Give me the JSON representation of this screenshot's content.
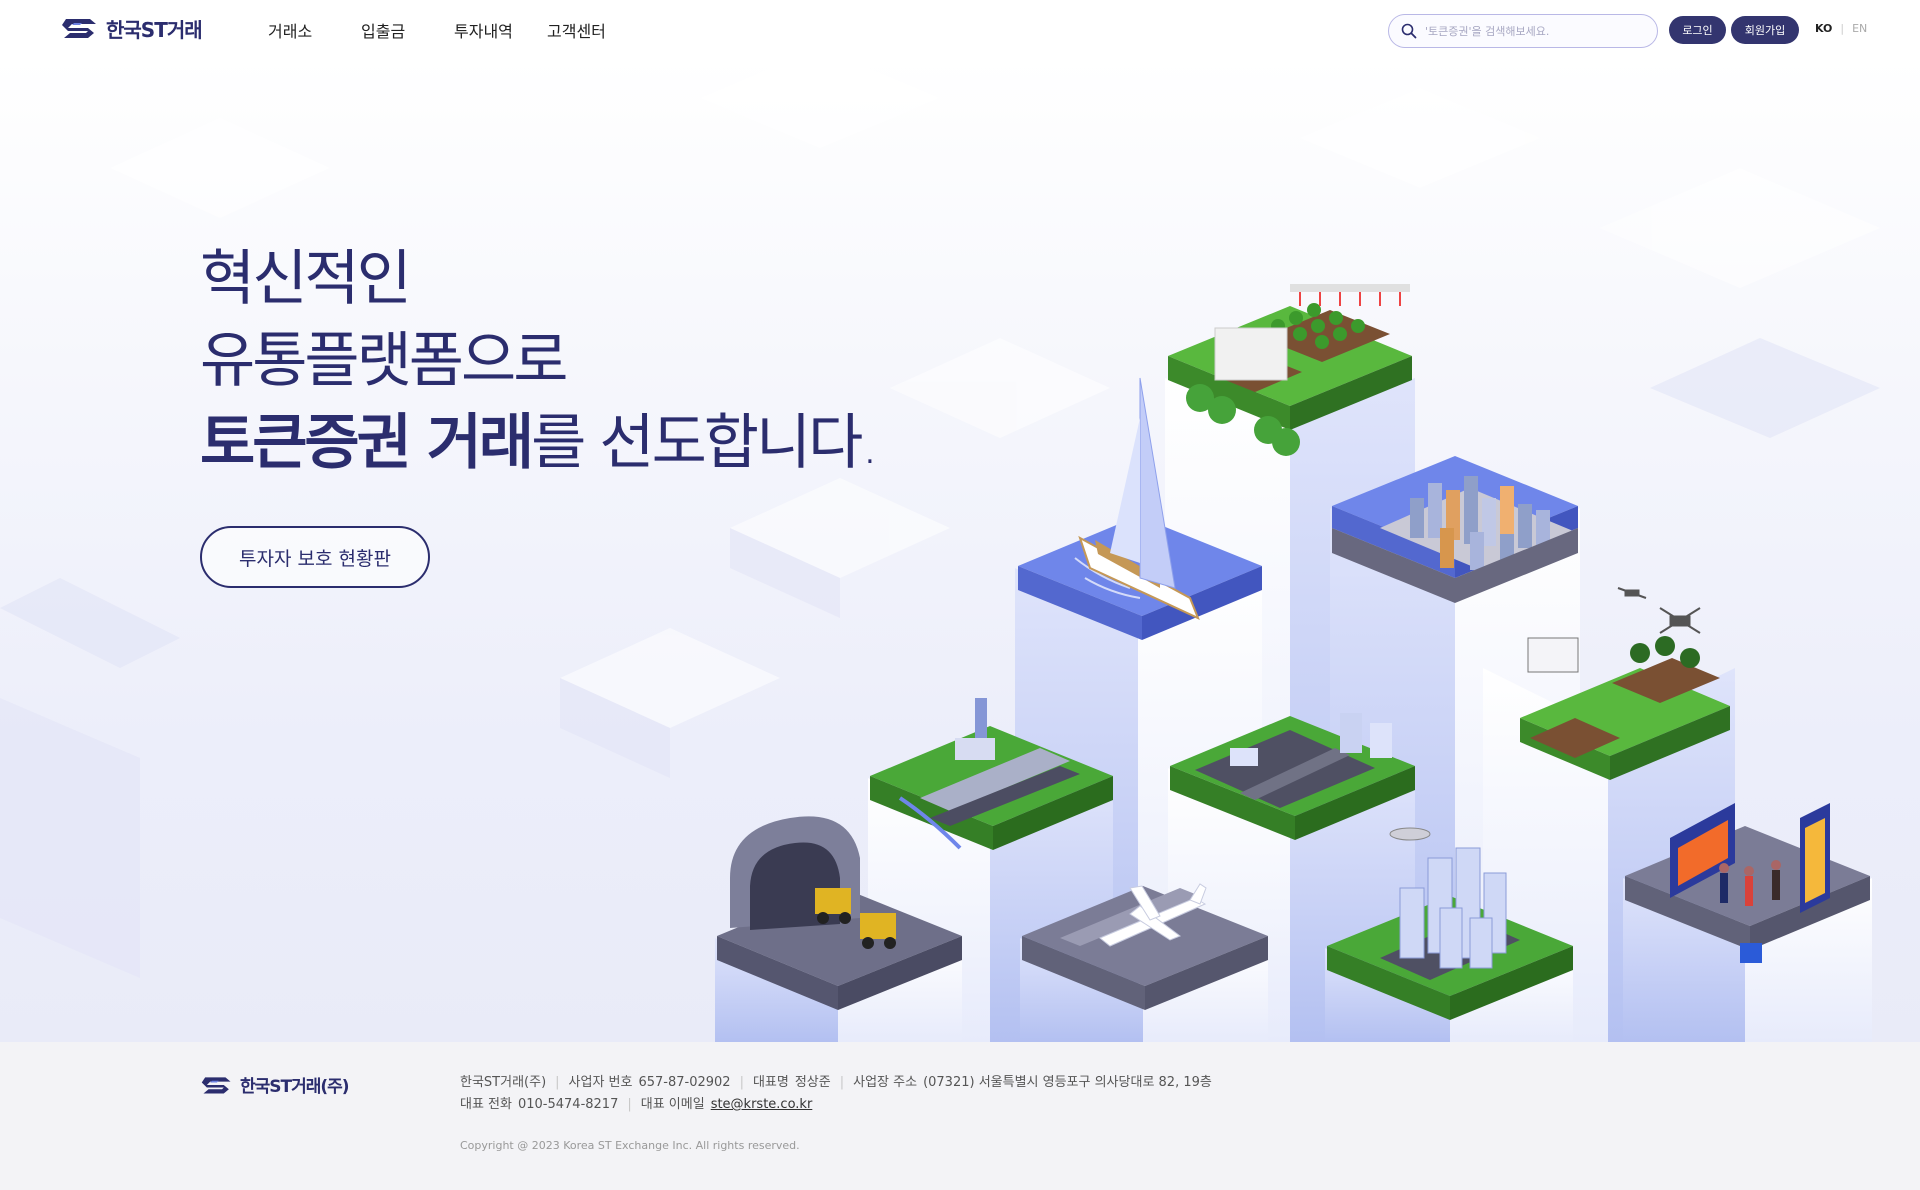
{
  "header": {
    "logo_text": "한국ST거래",
    "nav": [
      "거래소",
      "입출금",
      "투자내역",
      "고객센터"
    ],
    "search_placeholder": "'토큰증권'을 검색해보세요.",
    "login_label": "로그인",
    "join_label": "회원가입",
    "lang_ko": "KO",
    "lang_sep": "|",
    "lang_en": "EN"
  },
  "hero": {
    "line1": "혁신적인",
    "line2": "유통플랫폼으로",
    "line3_bold": "토큰증권 거래",
    "line3_rest": "를 선도합니다.",
    "cta_label": "투자자 보호 현황판"
  },
  "footer": {
    "logo_text": "한국ST거래(주)",
    "company": "한국ST거래(주)",
    "biz_no_label": "사업자 번호",
    "biz_no": "657-87-02902",
    "ceo_label": "대표명",
    "ceo": "정상준",
    "address_label": "사업장 주소",
    "address": "(07321) 서울특별시 영등포구 의사당대로 82, 19층",
    "phone_label": "대표 전화",
    "phone": "010-5474-8217",
    "email_label": "대표 이메일",
    "email": "ste@krste.co.kr",
    "copyright": "Copyright @ 2023 Korea ST Exchange Inc. All rights reserved."
  },
  "colors": {
    "brand_navy": "#2b2d6e",
    "button_navy": "#33356f",
    "pillar": "#c4cdf4",
    "grass": "#4aa838",
    "water": "#6f86ea",
    "road": "#6f7089"
  },
  "icons": [
    "logo-mark-icon",
    "search-icon"
  ]
}
